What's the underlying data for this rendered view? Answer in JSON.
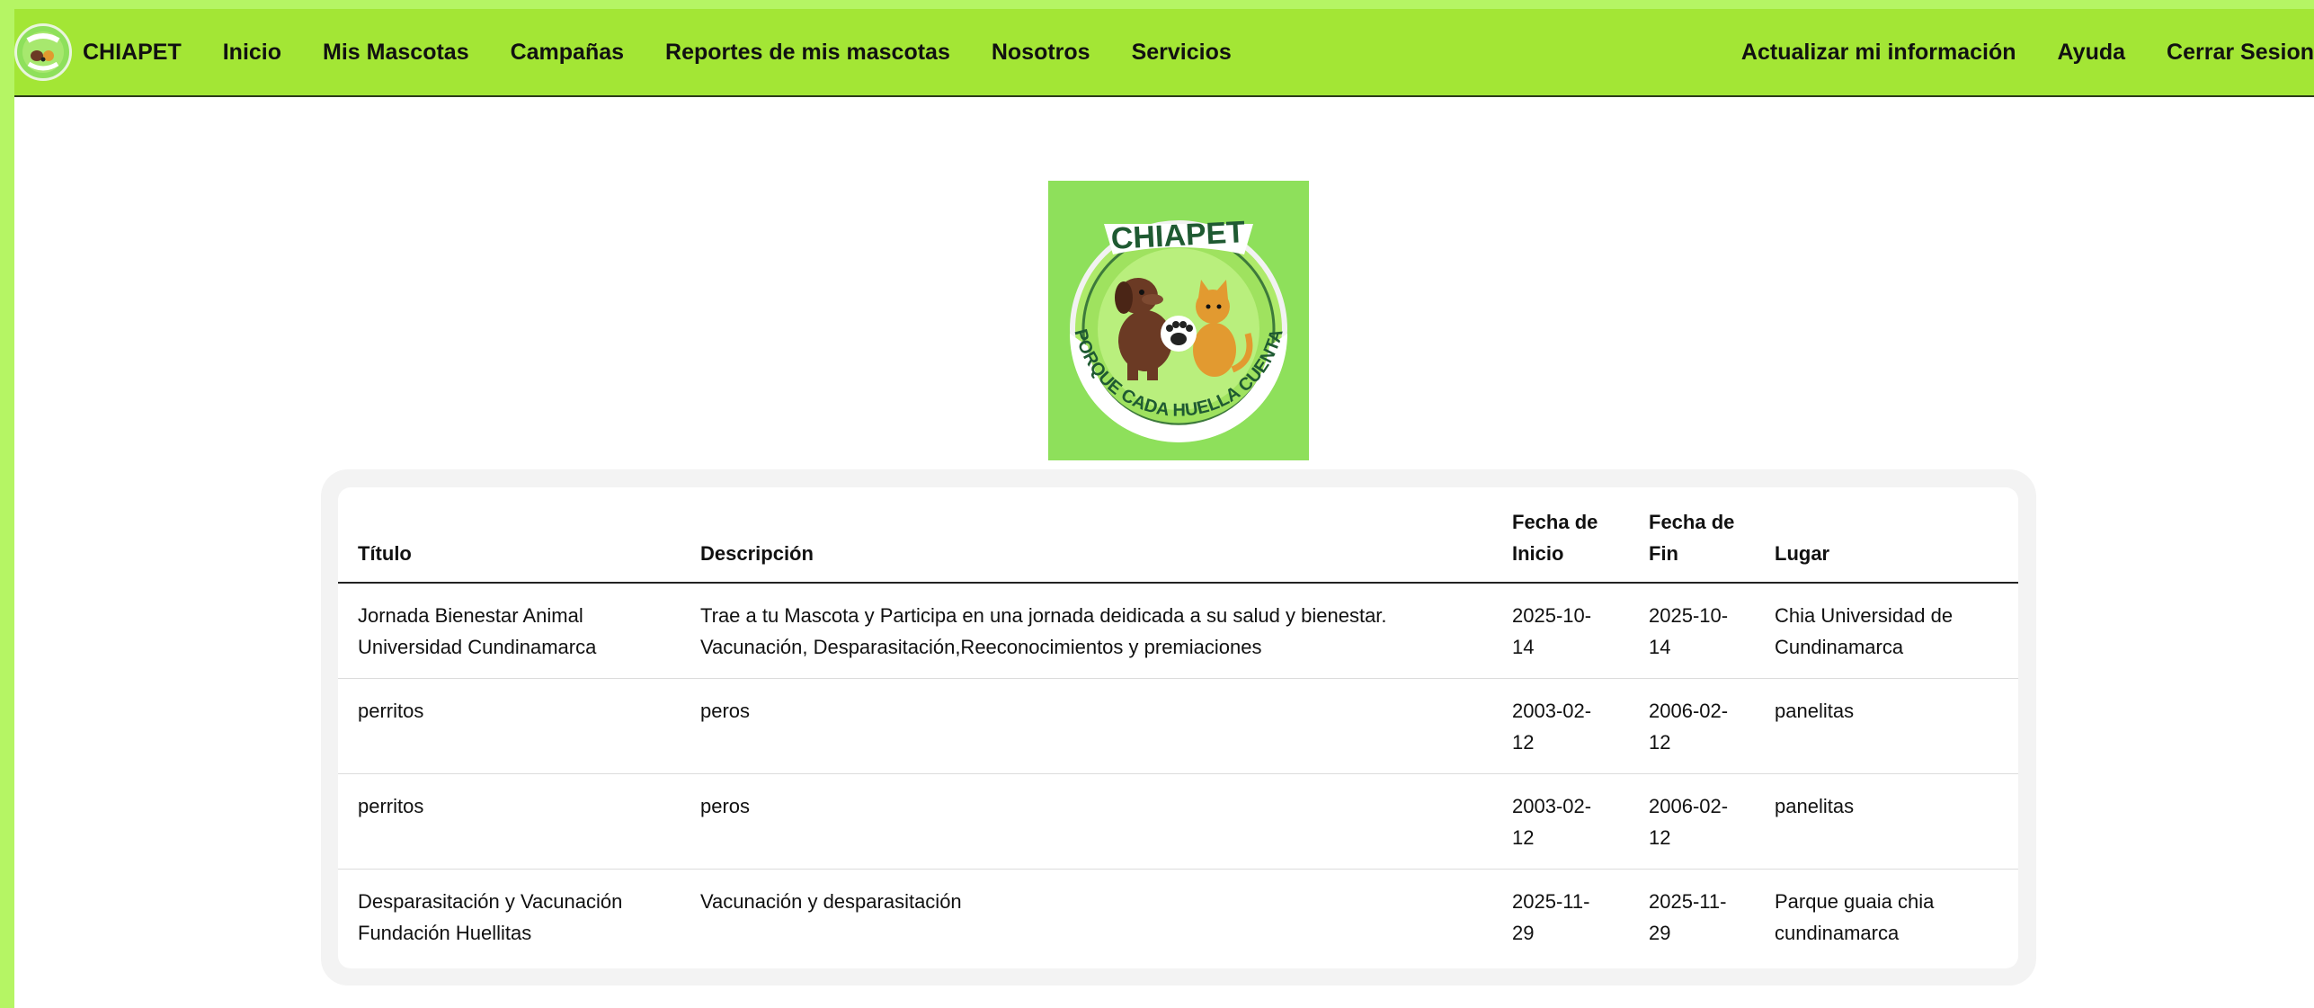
{
  "navbar": {
    "brand": "CHIAPET",
    "left_links": [
      "Inicio",
      "Mis Mascotas",
      "Campañas",
      "Reportes de mis mascotas",
      "Nosotros",
      "Servicios"
    ],
    "right_links": [
      "Actualizar mi información",
      "Ayuda",
      "Cerrar Sesion"
    ]
  },
  "logo": {
    "title": "CHIAPET",
    "slogan": "\"PORQUE CADA HUELLA CUENTA\""
  },
  "table": {
    "headers": [
      "Título",
      "Descripción",
      "Fecha de Inicio",
      "Fecha de Fin",
      "Lugar"
    ],
    "rows": [
      [
        "Jornada Bienestar Animal Universidad Cundinamarca",
        "Trae a tu Mascota y Participa en una jornada deidicada a su salud y bienestar. Vacunación, Desparasitación,Reeconocimientos y premiaciones",
        "2025-10-14",
        "2025-10-14",
        "Chia Universidad de Cundinamarca"
      ],
      [
        "perritos",
        "peros",
        "2003-02-12",
        "2006-02-12",
        "panelitas"
      ],
      [
        "perritos",
        "peros",
        "2003-02-12",
        "2006-02-12",
        "panelitas"
      ],
      [
        "Desparasitación y Vacunación Fundación Huellitas",
        "Vacunación y desparasitación",
        "2025-11-29",
        "2025-11-29",
        "Parque guaia chia cundinamarca"
      ]
    ]
  },
  "colors": {
    "navbar": "#a3e635",
    "frame": "#b5f564",
    "logo_bg": "#8ee05b"
  }
}
